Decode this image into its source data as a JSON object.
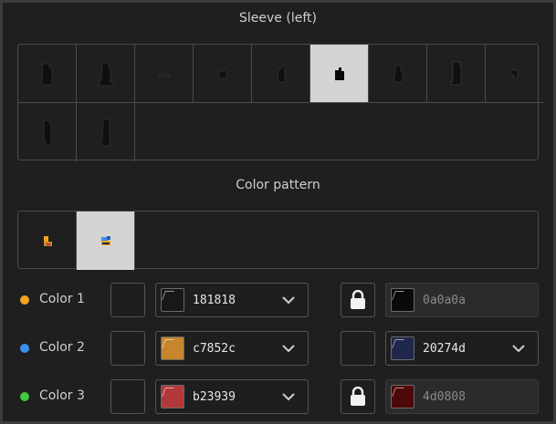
{
  "sleeve": {
    "title": "Sleeve (left)",
    "items": [
      {
        "icon": "sleeve-variant-1-icon",
        "selected": false
      },
      {
        "icon": "sleeve-variant-2-icon",
        "selected": false
      },
      {
        "icon": "sleeve-variant-3-icon",
        "selected": false
      },
      {
        "icon": "sleeve-variant-4-icon",
        "selected": false
      },
      {
        "icon": "sleeve-variant-5-icon",
        "selected": false
      },
      {
        "icon": "sleeve-variant-6-icon",
        "selected": true
      },
      {
        "icon": "sleeve-variant-7-icon",
        "selected": false
      },
      {
        "icon": "sleeve-variant-8-icon",
        "selected": false
      },
      {
        "icon": "sleeve-variant-9-icon",
        "selected": false
      },
      {
        "icon": "sleeve-variant-10-icon",
        "selected": false
      },
      {
        "icon": "sleeve-variant-11-icon",
        "selected": false
      }
    ]
  },
  "pattern": {
    "title": "Color pattern",
    "items": [
      {
        "icon": "pattern-variant-1-icon",
        "selected": false
      },
      {
        "icon": "pattern-variant-2-icon",
        "selected": true
      }
    ]
  },
  "colors": [
    {
      "label": "Color 1",
      "dot": "#f4a31c",
      "main_hex": "181818",
      "main_swatch": "#181818",
      "locked": true,
      "alt_hex": "0a0a0a",
      "alt_swatch": "#0a0a0a"
    },
    {
      "label": "Color 2",
      "dot": "#3a8fe8",
      "main_hex": "c7852c",
      "main_swatch": "#c7852c",
      "locked": false,
      "alt_hex": "20274d",
      "alt_swatch": "#20274d"
    },
    {
      "label": "Color 3",
      "dot": "#3fc93f",
      "main_hex": "b23939",
      "main_swatch": "#b23939",
      "locked": true,
      "alt_hex": "4d0808",
      "alt_swatch": "#4d0808"
    }
  ]
}
